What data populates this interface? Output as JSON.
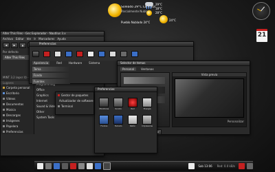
{
  "weather": {
    "city_temp": "Soleado 29°C",
    "forecast_1": "Parcialmente Nublado",
    "forecast_2": "Pueblo Nublado 24°C",
    "temps": [
      "29°C",
      "18°C",
      "28°C",
      "24°C"
    ],
    "top_label": "Soleado 29°C La Plata"
  },
  "calendar": {
    "day": "21",
    "month": "Oct"
  },
  "file_manager": {
    "title": "Alter This Files - Gec Explorador - Nautilus 3.x",
    "menu": [
      "Archivo",
      "Editar",
      "Ver",
      "Ir",
      "Marcadores",
      "Ayuda"
    ],
    "location": "Por defecto",
    "tab": "Alter This Files",
    "info": "MINT 3.2 (epsr it) - 258 GB",
    "sidebar_header": "Lugares",
    "sidebar": [
      "Carpeta personal",
      "Escritorio",
      "Videos",
      "Documentos",
      "Música",
      "Descargas",
      "Imágenes",
      "Papelera",
      "Preferencias"
    ],
    "categories": [
      "Programming",
      "Office",
      "Graphics",
      "Internet",
      "Sound & Video",
      "Other",
      "System Tools"
    ]
  },
  "preferences": {
    "title": "Preferencias",
    "tabs": [
      "Apariencia",
      "Red",
      "Hardware",
      "Sistema"
    ],
    "section_labels": [
      "Tema",
      "Fondo",
      "Fuentes"
    ]
  },
  "color_dialog": {
    "title": "Selector de temas",
    "tabs": [
      "Personal",
      "Ventanas"
    ],
    "preview_label": "Vista previa",
    "buttons": [
      "Instalar",
      "Borrar",
      "Cerrar"
    ],
    "customize": "Personalizar"
  },
  "small_window": {
    "title": "Preferencias",
    "items": [
      "Monitores",
      "Sonido",
      "Red",
      "Energía",
      "Fondos",
      "Teclado",
      "Ratón",
      "Impresoras"
    ],
    "dock_items": [
      "Gestor de paquetes",
      "Actualizador de software",
      "Terminal"
    ]
  },
  "taskbar": {
    "clock": "Sab 13:06",
    "date": "21 oct 2012",
    "status": "Red: 0.0 kB/s"
  },
  "colors": {
    "accent_red": "#c42020",
    "accent_blue": "#3b6fc7",
    "sun": "#f2b500"
  }
}
